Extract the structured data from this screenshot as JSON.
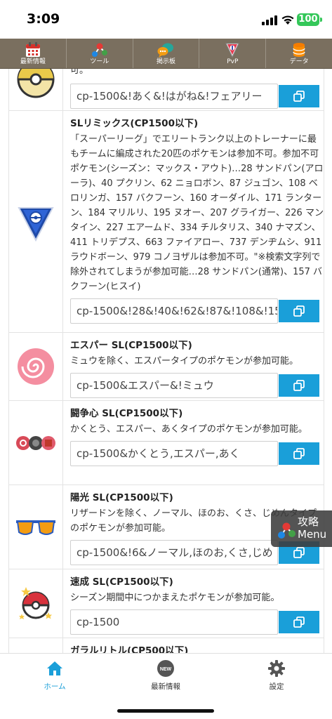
{
  "status_bar": {
    "time": "3:09",
    "battery": "100"
  },
  "top_nav": {
    "items": [
      {
        "label": "最新情報"
      },
      {
        "label": "ツール"
      },
      {
        "label": "掲示板"
      },
      {
        "label": "PvP"
      },
      {
        "label": "データ"
      }
    ]
  },
  "rows": [
    {
      "title": "",
      "desc": "可。",
      "search_value": "cp-1500&!あく&!はがね&!フェアリー"
    },
    {
      "title": "SLリミックス(CP1500以下)",
      "desc": "「スーパーリーグ」でエリートランク以上のトレーナーに最もチームに編成された20匹のポケモンは参加不可。参加不可ポケモン(シーズン：マックス・アウト)…28 サンドパン(アローラ)、40 プクリン、62 ニョロボン、87 ジュゴン、108 ベロリンガ、157 バクフーン、160 オーダイル、171 ランターン、184 マリルリ、195 ヌオー、207 グライガー、226 マンタイン、227 エアームド、334 チルタリス、340 ナマズン、411 トリデプス、663 ファイアロー、737 デンヂムシ、911 ラウドボーン、979 コノヨザルは参加不可。\"※検索文字列で除外されてしまうが参加可能…28 サンドパン(通常)、157 バクフーン(ヒスイ)",
      "search_value": "cp-1500&!28&!40&!62&!87&!108&!15"
    },
    {
      "title": "エスパー SL(CP1500以下)",
      "desc": "ミュウを除く、エスパータイプのポケモンが参加可能。",
      "search_value": "cp-1500&エスパー&!ミュウ"
    },
    {
      "title": "闘争心 SL(CP1500以下)",
      "desc": "かくとう、エスパー、あくタイプのポケモンが参加可能。",
      "search_value": "cp-1500&かくとう,エスパー,あく"
    },
    {
      "title": "陽光 SL(CP1500以下)",
      "desc": "リザードンを除く、ノーマル、ほのお、くさ、じめんタイプのポケモンが参加可能。",
      "search_value": "cp-1500&!6&ノーマル,ほのお,くさ,じめ"
    },
    {
      "title": "速成 SL(CP1500以下)",
      "desc": "シーズン期間中につかまえたポケモンが参加可能。",
      "search_value": "cp-1500"
    },
    {
      "title": "ガラルリトル(CP500以下)",
      "desc": "",
      "search_value": ""
    }
  ],
  "floating_menu": {
    "line1": "攻略",
    "line2": "Menu"
  },
  "tab_bar": {
    "tabs": [
      {
        "label": "ホーム"
      },
      {
        "label": "最新情報",
        "badge": "NEW"
      },
      {
        "label": "設定"
      }
    ]
  },
  "colors": {
    "accent": "#1a9fd9",
    "nav_bg": "#7a6f5f"
  }
}
